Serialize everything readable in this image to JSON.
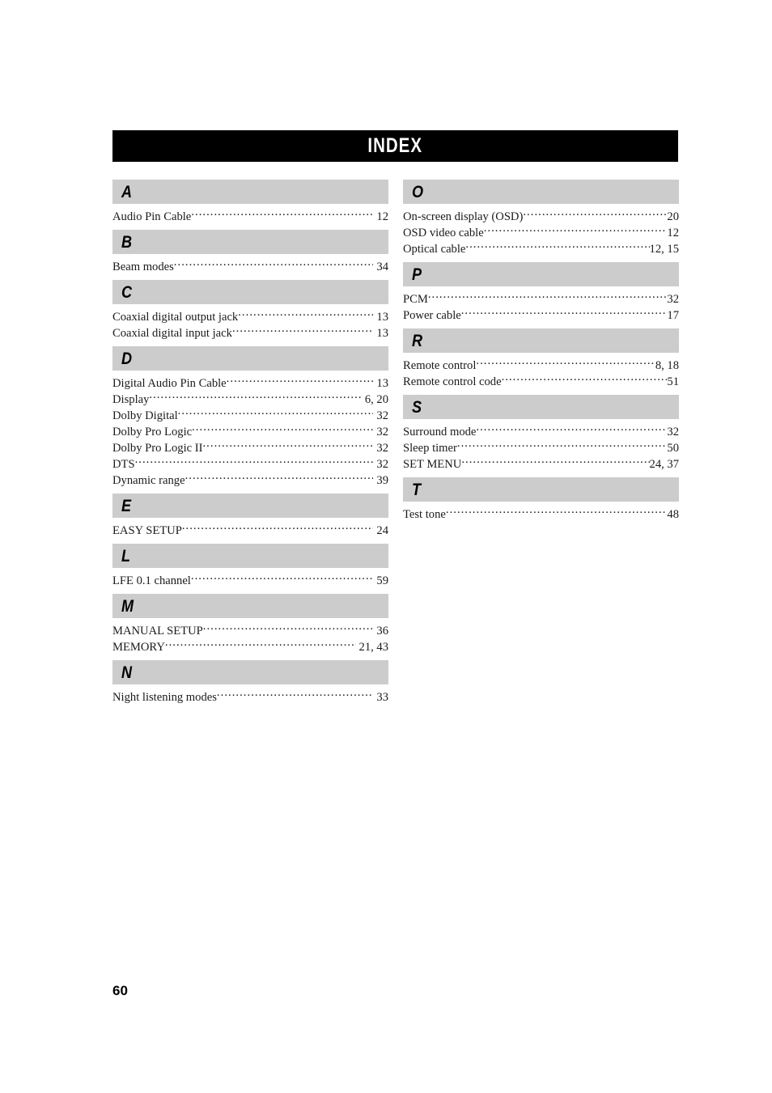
{
  "banner": {
    "title": "INDEX",
    "background_color": "#000000",
    "text_color": "#ffffff"
  },
  "theme": {
    "letter_bar_color": "#cccccc",
    "text_color": "#1a1a1a",
    "page_background": "#ffffff"
  },
  "footer": {
    "page_number": "60"
  },
  "columns": {
    "left": {
      "sections": [
        {
          "letter": "A",
          "entries": [
            {
              "label": "Audio Pin Cable",
              "page": "12"
            }
          ]
        },
        {
          "letter": "B",
          "entries": [
            {
              "label": "Beam modes",
              "page": "34"
            }
          ]
        },
        {
          "letter": "C",
          "entries": [
            {
              "label": "Coaxial digital output jack",
              "page": "13"
            },
            {
              "label": "Coaxial digital input jack",
              "page": "13"
            }
          ]
        },
        {
          "letter": "D",
          "entries": [
            {
              "label": "Digital Audio Pin Cable",
              "page": "13"
            },
            {
              "label": "Display",
              "page": "6, 20"
            },
            {
              "label": "Dolby Digital",
              "page": "32"
            },
            {
              "label": "Dolby Pro Logic",
              "page": "32"
            },
            {
              "label": "Dolby Pro Logic II",
              "page": "32"
            },
            {
              "label": "DTS",
              "page": "32"
            },
            {
              "label": "Dynamic range",
              "page": "39"
            }
          ]
        },
        {
          "letter": "E",
          "entries": [
            {
              "label": "EASY SETUP",
              "page": "24"
            }
          ]
        },
        {
          "letter": "L",
          "entries": [
            {
              "label": "LFE 0.1 channel",
              "page": "59"
            }
          ]
        },
        {
          "letter": "M",
          "entries": [
            {
              "label": "MANUAL SETUP",
              "page": "36"
            },
            {
              "label": "MEMORY",
              "page": "21, 43"
            }
          ]
        },
        {
          "letter": "N",
          "entries": [
            {
              "label": "Night listening modes",
              "page": "33"
            }
          ]
        }
      ]
    },
    "right": {
      "sections": [
        {
          "letter": "O",
          "entries": [
            {
              "label": "On-screen display (OSD)",
              "page": "20"
            },
            {
              "label": "OSD video cable",
              "page": "12"
            },
            {
              "label": "Optical cable",
              "page": "12, 15"
            }
          ]
        },
        {
          "letter": "P",
          "entries": [
            {
              "label": "PCM",
              "page": "32"
            },
            {
              "label": "Power cable",
              "page": "17"
            }
          ]
        },
        {
          "letter": "R",
          "entries": [
            {
              "label": "Remote control",
              "page": "8, 18"
            },
            {
              "label": "Remote control code",
              "page": "51"
            }
          ]
        },
        {
          "letter": "S",
          "entries": [
            {
              "label": "Surround mode",
              "page": "32"
            },
            {
              "label": "Sleep timer",
              "page": "50"
            },
            {
              "label": "SET MENU",
              "page": "24, 37"
            }
          ]
        },
        {
          "letter": "T",
          "entries": [
            {
              "label": "Test tone",
              "page": "48"
            }
          ]
        }
      ]
    }
  }
}
